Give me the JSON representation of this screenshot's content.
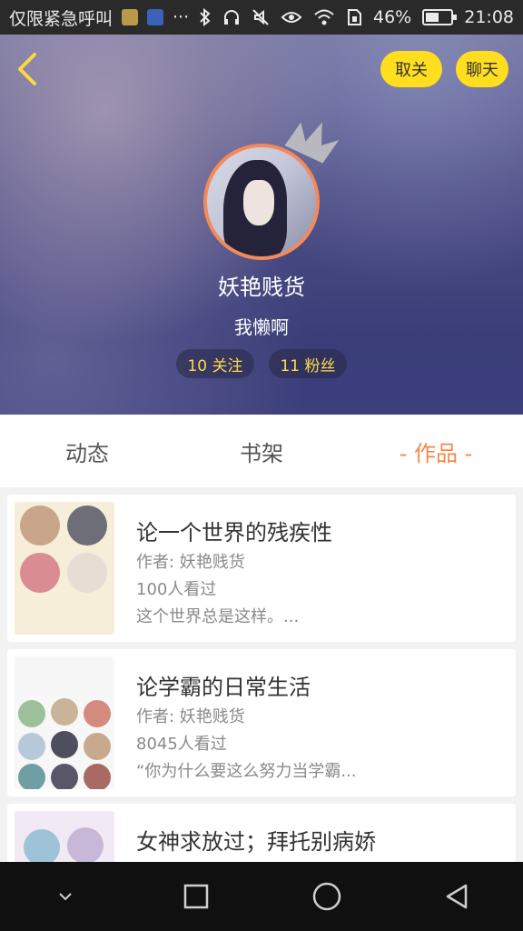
{
  "status_bar": {
    "carrier": "仅限紧急呼叫",
    "more": "···",
    "battery_percent": "46%",
    "battery_level": 0.46,
    "time": "21:08"
  },
  "header": {
    "unfollow_label": "取关",
    "chat_label": "聊天",
    "nickname": "妖艳贱货",
    "signature": "我懒啊",
    "following": "10 关注",
    "fans": "11 粉丝"
  },
  "tabs": [
    {
      "label": "动态"
    },
    {
      "label": "书架"
    },
    {
      "label": "- 作品 -"
    }
  ],
  "works": [
    {
      "title": "论一个世界的残疾性",
      "author": "作者: 妖艳贱货",
      "views": "100人看过",
      "desc": "这个世界总是这样。..."
    },
    {
      "title": "论学霸的日常生活",
      "author": "作者: 妖艳贱货",
      "views": "8045人看过",
      "desc": "“你为什么要这么努力当学霸..."
    },
    {
      "title": "女神求放过；拜托别病娇",
      "author": "",
      "views": "",
      "desc": ""
    }
  ],
  "colors": {
    "accent_yellow": "#ffde1f",
    "tab_active": "#f5884a",
    "avatar_ring": "#f48a5a"
  }
}
